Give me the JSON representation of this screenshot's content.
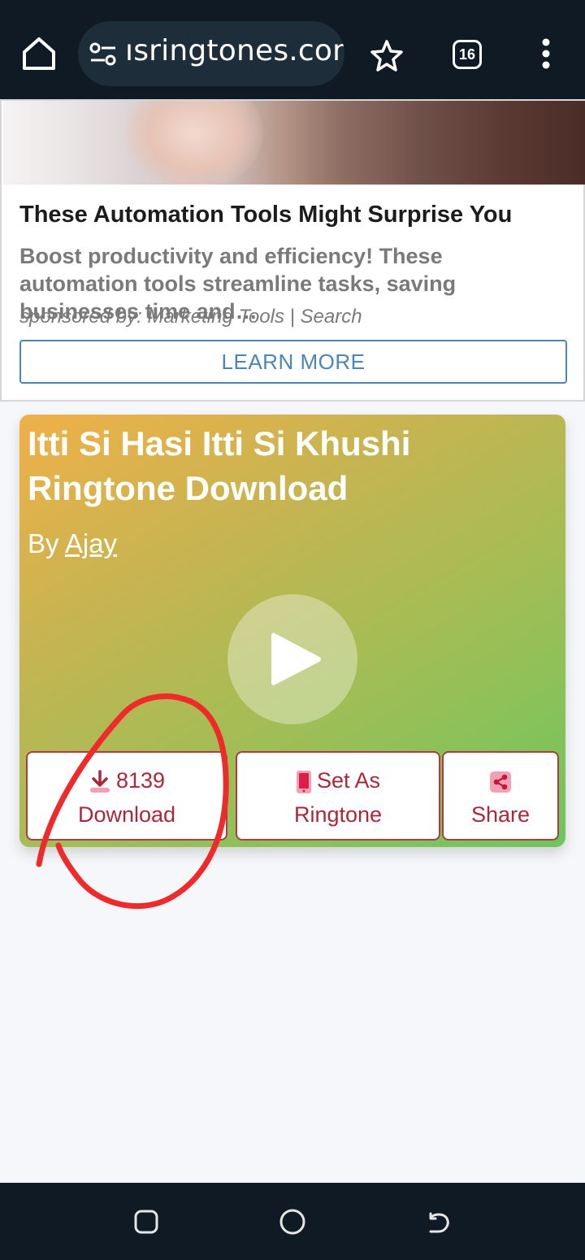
{
  "browser": {
    "url": "ısringtones.com",
    "tab_count": "16"
  },
  "ad": {
    "title": "These Automation Tools Might Surprise You",
    "body": "Boost productivity and efficiency! These automation tools streamline tasks, saving businesses time and…",
    "sponsor": "sponsored by: Marketing Tools | Search",
    "cta": "LEARN MORE"
  },
  "ringtone": {
    "title": "Itti Si Hasi Itti Si Khushi Ringtone Download",
    "by_prefix": "By ",
    "author": "Ajay",
    "actions": {
      "download_count": "8139",
      "download_label": "Download",
      "set_as_line1": "Set As",
      "set_as_line2": "Ringtone",
      "share_label": "Share"
    }
  },
  "colors": {
    "toolbar_bg": "#0f1a24",
    "accent_red": "#a9283a",
    "cta_blue": "#4a86b8",
    "card_gradient_start": "#f0b048",
    "card_gradient_end": "#6dc65e",
    "annotation": "#ee2a2a"
  },
  "icons": [
    "home-icon",
    "site-settings-icon",
    "bookmark-star-icon",
    "tab-switcher-icon",
    "overflow-menu-icon",
    "play-icon",
    "download-icon",
    "phone-icon",
    "share-icon",
    "recents-icon",
    "nav-home-icon",
    "back-icon"
  ]
}
